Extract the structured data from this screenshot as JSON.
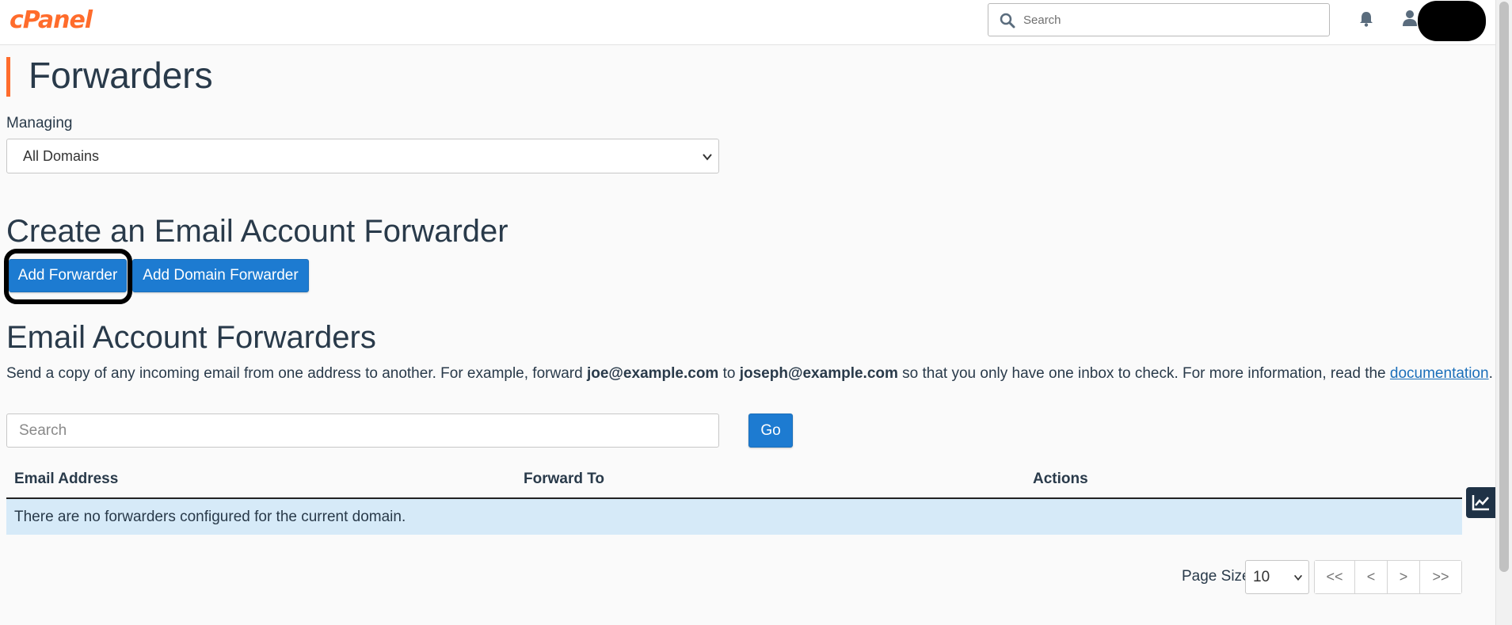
{
  "header": {
    "logo": "cPanel",
    "search_placeholder": "Search"
  },
  "page": {
    "title": "Forwarders",
    "managing_label": "Managing",
    "managing_selected": "All Domains"
  },
  "create_section": {
    "heading": "Create an Email Account Forwarder",
    "add_forwarder_label": "Add Forwarder",
    "add_domain_forwarder_label": "Add Domain Forwarder"
  },
  "forwarders_section": {
    "heading": "Email Account Forwarders",
    "desc_part1": "Send a copy of any incoming email from one address to another. For example, forward ",
    "desc_email1": "joe@example.com",
    "desc_part2": " to ",
    "desc_email2": "joseph@example.com",
    "desc_part3": " so that you only have one inbox to check. For more information, read the ",
    "desc_link": "documentation",
    "desc_end": ".",
    "search_placeholder": "Search",
    "go_label": "Go"
  },
  "table": {
    "columns": [
      "Email Address",
      "Forward To",
      "Actions"
    ],
    "empty_message": "There are no forwarders configured for the current domain."
  },
  "pagination": {
    "page_size_label": "Page Size",
    "page_size_value": "10",
    "first": "<<",
    "prev": "<",
    "next": ">",
    "last": ">>"
  },
  "colors": {
    "brand": "#ff6c2c",
    "primary_button": "#1d7bd1",
    "empty_row_bg": "#d6eaf8",
    "text": "#293a4a"
  }
}
